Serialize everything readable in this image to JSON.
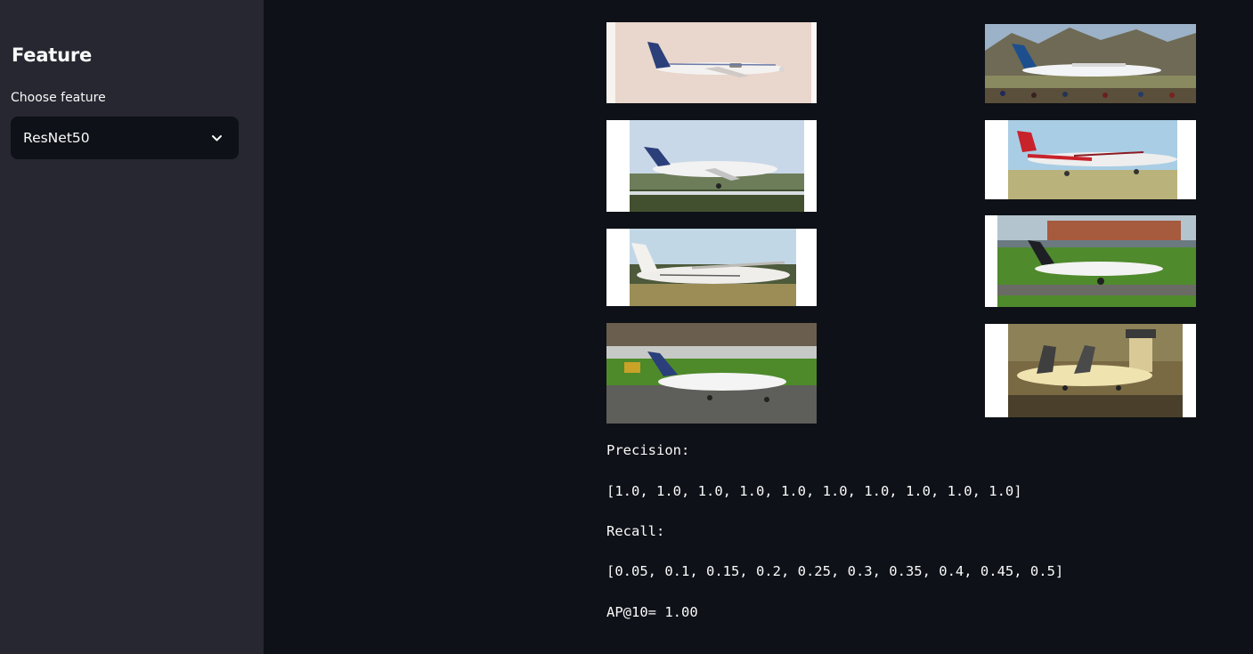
{
  "sidebar": {
    "title": "Feature",
    "select_label": "Choose feature",
    "select_value": "ResNet50"
  },
  "results": {
    "images": [
      {
        "icon": "aircraft-photo",
        "scene": "bae146-sky"
      },
      {
        "icon": "aircraft-photo",
        "scene": "atr72-mountains"
      },
      {
        "icon": "aircraft-photo",
        "scene": "jetstream-takeoff"
      },
      {
        "icon": "aircraft-photo",
        "scene": "carvair-grass"
      },
      {
        "icon": "aircraft-photo",
        "scene": "c212-field"
      },
      {
        "icon": "aircraft-photo",
        "scene": "jetstream-apron"
      },
      {
        "icon": "aircraft-photo",
        "scene": "jetstream-taxi"
      },
      {
        "icon": "aircraft-photo",
        "scene": "herald-tower"
      }
    ],
    "precision_label": "Precision:",
    "precision_values": "[1.0, 1.0, 1.0, 1.0, 1.0, 1.0, 1.0, 1.0, 1.0, 1.0]",
    "recall_label": "Recall:",
    "recall_values": "[0.05, 0.1, 0.15, 0.2, 0.25, 0.3, 0.35, 0.4, 0.45, 0.5]",
    "ap_text": "AP@10= 1.00"
  },
  "colors": {
    "main_bg": "#0e1117",
    "sidebar_bg": "#262730",
    "text": "#fafafa"
  }
}
